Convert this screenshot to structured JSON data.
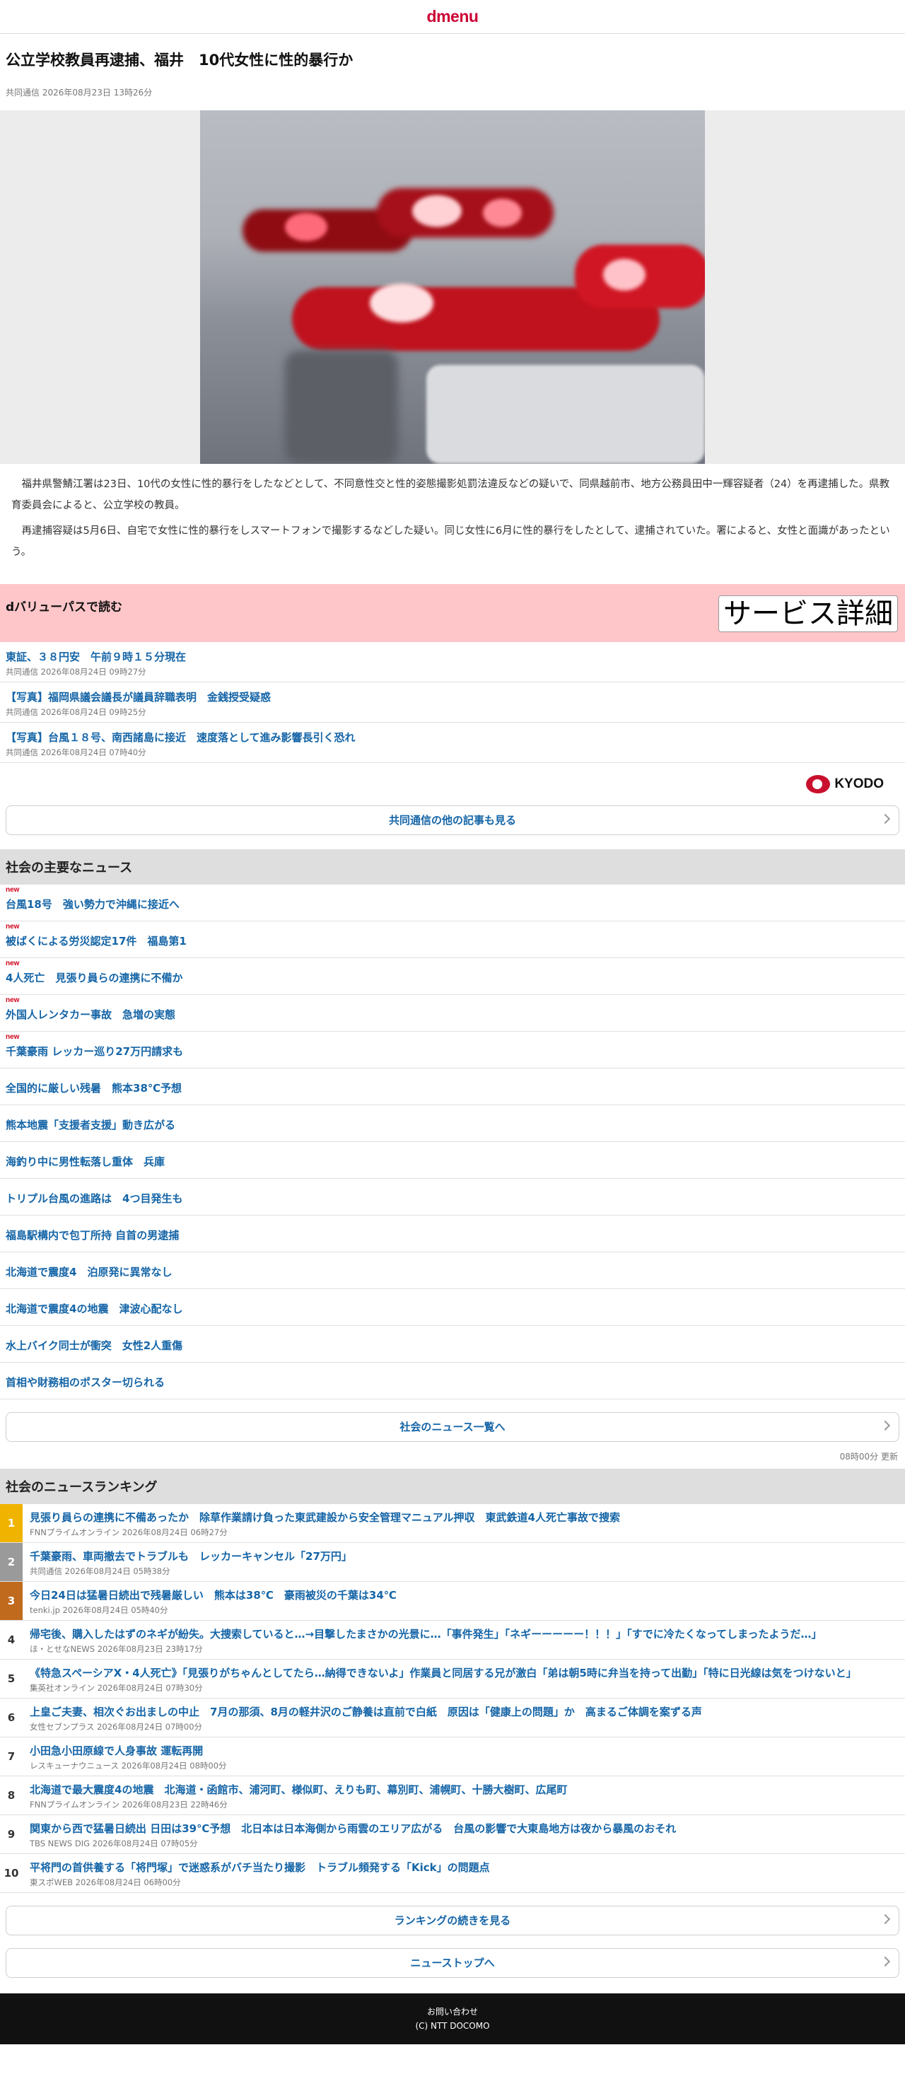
{
  "header": {
    "logo": "dmenu"
  },
  "article": {
    "title": "公立学校教員再逮捕、福井　10代女性に性的暴行か",
    "meta": "共同通信 2026年08月23日 13時26分",
    "paragraphs": [
      "福井県警鯖江署は23日、10代の女性に性的暴行をしたなどとして、不同意性交と性的姿態撮影処罰法違反などの疑いで、同県越前市、地方公務員田中一輝容疑者（24）を再逮捕した。県教育委員会によると、公立学校の教員。",
      "再逮捕容疑は5月6日、自宅で女性に性的暴行をしスマートフォンで撮影するなどした疑い。同じ女性に6月に性的暴行をしたとして、逮捕されていた。署によると、女性と面識があったという。"
    ]
  },
  "dvalue": {
    "title": "dバリューパスで読む",
    "button": "サービス詳細"
  },
  "related": [
    {
      "title": "東証、３８円安　午前９時１５分現在",
      "meta": "共同通信 2026年08月24日 09時27分"
    },
    {
      "title": "【写真】福岡県議会議長が議員辞職表明　金銭授受疑惑",
      "meta": "共同通信 2026年08月24日 09時25分"
    },
    {
      "title": "【写真】台風１８号、南西諸島に接近　速度落として進み影響長引く恐れ",
      "meta": "共同通信 2026年08月24日 07時40分"
    }
  ],
  "kyodo": {
    "logo_text": "KYODO"
  },
  "more_kyodo": "共同通信の他の記事も見る",
  "society_news": {
    "heading": "社会の主要なニュース",
    "new_label": "new",
    "items": [
      {
        "title": "台風18号　強い勢力で沖縄に接近へ",
        "is_new": true
      },
      {
        "title": "被ばくによる労災認定17件　福島第1",
        "is_new": true
      },
      {
        "title": "4人死亡　見張り員らの連携に不備か",
        "is_new": true
      },
      {
        "title": "外国人レンタカー事故　急増の実態",
        "is_new": true
      },
      {
        "title": "千葉豪雨 レッカー巡り27万円請求も",
        "is_new": true
      },
      {
        "title": "全国的に厳しい残暑　熊本38℃予想",
        "is_new": false
      },
      {
        "title": "熊本地震「支援者支援」動き広がる",
        "is_new": false
      },
      {
        "title": "海釣り中に男性転落し重体　兵庫",
        "is_new": false
      },
      {
        "title": "トリプル台風の進路は　4つ目発生も",
        "is_new": false
      },
      {
        "title": "福島駅構内で包丁所持 自首の男逮捕",
        "is_new": false
      },
      {
        "title": "北海道で震度4　泊原発に異常なし",
        "is_new": false
      },
      {
        "title": "北海道で震度4の地震　津波心配なし",
        "is_new": false
      },
      {
        "title": "水上バイク同士が衝突　女性2人重傷",
        "is_new": false
      },
      {
        "title": "首相や財務相のポスター切られる",
        "is_new": false
      }
    ],
    "more": "社会のニュース一覧へ",
    "updated": "08時00分 更新"
  },
  "ranking": {
    "heading": "社会のニュースランキング",
    "items": [
      {
        "rank": "1",
        "title": "見張り員らの連携に不備あったか　除草作業請け負った東武建設から安全管理マニュアル押収　東武鉄道4人死亡事故で捜索",
        "meta": "FNNプライムオンライン 2026年08月24日 06時27分"
      },
      {
        "rank": "2",
        "title": "千葉豪雨、車両撤去でトラブルも　レッカーキャンセル「27万円」",
        "meta": "共同通信 2026年08月24日 05時38分"
      },
      {
        "rank": "3",
        "title": "今日24日は猛暑日続出で残暑厳しい　熊本は38℃　豪雨被災の千葉は34℃",
        "meta": "tenki.jp 2026年08月24日 05時40分"
      },
      {
        "rank": "4",
        "title": "帰宅後、購入したはずのネギが紛失。大捜索していると…→目撃したまさかの光景に…「事件発生」「ネギーーーーー！！！」「すでに冷たくなってしまったようだ…」",
        "meta": "ほ・とせなNEWS 2026年08月23日 23時17分"
      },
      {
        "rank": "5",
        "title": "《特急スペーシアX・4人死亡》「見張りがちゃんとしてたら…納得できないよ」作業員と同居する兄が激白「弟は朝5時に弁当を持って出勤」「特に日光線は気をつけないと」",
        "meta": "集英社オンライン 2026年08月24日 07時30分"
      },
      {
        "rank": "6",
        "title": "上皇ご夫妻、相次ぐお出ましの中止　7月の那須、8月の軽井沢のご静養は直前で白紙　原因は「健康上の問題」か　高まるご体調を案ずる声",
        "meta": "女性セブンプラス 2026年08月24日 07時00分"
      },
      {
        "rank": "7",
        "title": "小田急小田原線で人身事故 運転再開",
        "meta": "レスキューナウニュース 2026年08月24日 08時00分"
      },
      {
        "rank": "8",
        "title": "北海道で最大震度4の地震　北海道・函館市、浦河町、様似町、えりも町、幕別町、浦幌町、十勝大樹町、広尾町",
        "meta": "FNNプライムオンライン 2026年08月23日 22時46分"
      },
      {
        "rank": "9",
        "title": "関東から西で猛暑日続出 日田は39℃予想　北日本は日本海側から雨雲のエリア広がる　台風の影響で大東島地方は夜から暴風のおそれ",
        "meta": "TBS NEWS DIG 2026年08月24日 07時05分"
      },
      {
        "rank": "10",
        "title": "平将門の首供養する「将門塚」で迷惑系がバチ当たり撮影　トラブル頻発する「Kick」の問題点",
        "meta": "東スポWEB 2026年08月24日 06時00分"
      }
    ],
    "more": "ランキングの続きを見る",
    "news_top": "ニューストップへ"
  },
  "footer": {
    "contact": "お問い合わせ",
    "copyright": "(C) NTT DOCOMO"
  }
}
